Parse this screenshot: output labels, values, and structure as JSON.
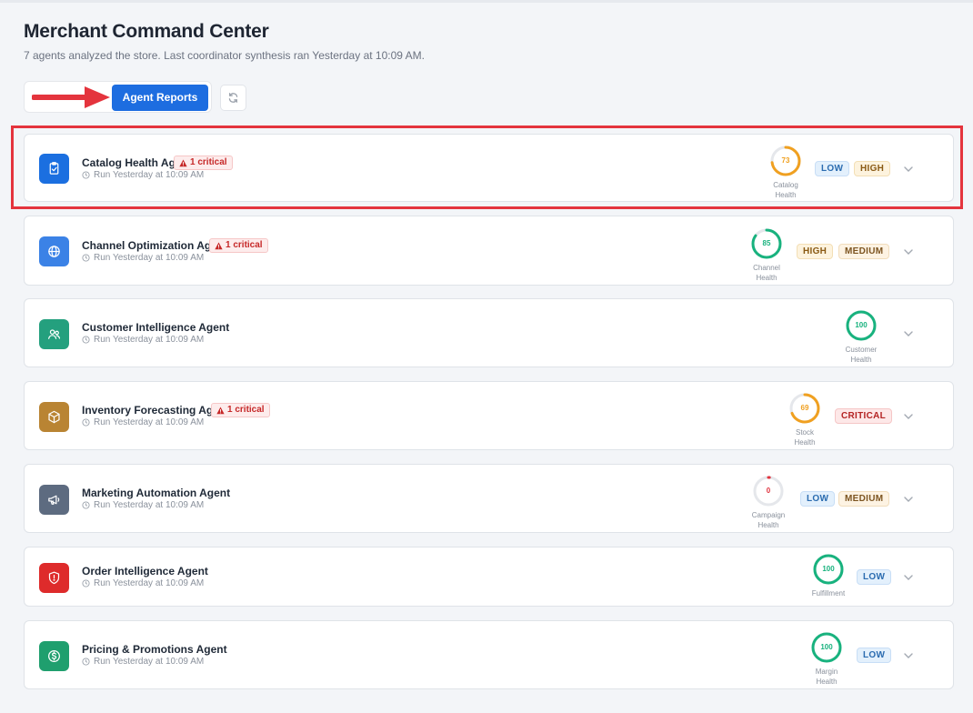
{
  "page": {
    "title": "Merchant Command Center",
    "subtitle": "7 agents analyzed the store. Last coordinator synthesis ran Yesterday at 10:09 AM."
  },
  "tabs": {
    "active_label": "Agent Reports"
  },
  "icons": {
    "refresh": "refresh-icon",
    "clock": "clock-icon",
    "chevron": "chevron-down-icon",
    "warning": "warning-triangle-icon"
  },
  "colors": {
    "accent": "#1d6de0",
    "highlight": "#e4343d",
    "gauge_orange": "#f0a020",
    "gauge_green": "#18b27e",
    "gauge_empty": "#e5e7eb"
  },
  "agents": [
    {
      "name": "Catalog Health Agent",
      "critical": "1 critical",
      "run": "Run Yesterday at 10:09 AM",
      "score": "73",
      "score_fraction": 0.73,
      "gauge_color": "#f0a020",
      "metric_line1": "Catalog",
      "metric_line2": "Health",
      "pills": [
        "LOW",
        "HIGH"
      ],
      "icon": "clipboard-check-icon",
      "icon_bg": "#1b6fe0"
    },
    {
      "name": "Channel Optimization Agent",
      "critical": "1 critical",
      "run": "Run Yesterday at 10:09 AM",
      "score": "85",
      "score_fraction": 0.85,
      "gauge_color": "#18b27e",
      "metric_line1": "Channel",
      "metric_line2": "Health",
      "pills": [
        "HIGH",
        "MEDIUM"
      ],
      "icon": "globe-icon",
      "icon_bg": "#3b82e6"
    },
    {
      "name": "Customer Intelligence Agent",
      "critical": "",
      "run": "Run Yesterday at 10:09 AM",
      "score": "100",
      "score_fraction": 1.0,
      "gauge_color": "#18b27e",
      "metric_line1": "Customer",
      "metric_line2": "Health",
      "pills": [],
      "icon": "users-icon",
      "icon_bg": "#24a07e"
    },
    {
      "name": "Inventory Forecasting Agent",
      "critical": "1 critical",
      "run": "Run Yesterday at 10:09 AM",
      "score": "69",
      "score_fraction": 0.69,
      "gauge_color": "#f0a020",
      "metric_line1": "Stock",
      "metric_line2": "Health",
      "pills": [
        "CRITICAL"
      ],
      "icon": "box-icon",
      "icon_bg": "#b98433"
    },
    {
      "name": "Marketing Automation Agent",
      "critical": "",
      "run": "Run Yesterday at 10:09 AM",
      "score": "0",
      "score_fraction": 0.0,
      "gauge_color": "#e0333e",
      "metric_line1": "Campaign",
      "metric_line2": "Health",
      "pills": [
        "LOW",
        "MEDIUM"
      ],
      "icon": "megaphone-icon",
      "icon_bg": "#5d6b80"
    },
    {
      "name": "Order Intelligence Agent",
      "critical": "",
      "run": "Run Yesterday at 10:09 AM",
      "score": "100",
      "score_fraction": 1.0,
      "gauge_color": "#18b27e",
      "metric_line1": "Fulfillment",
      "metric_line2": "",
      "pills": [
        "LOW"
      ],
      "icon": "shield-alert-icon",
      "icon_bg": "#de2b2b"
    },
    {
      "name": "Pricing & Promotions Agent",
      "critical": "",
      "run": "Run Yesterday at 10:09 AM",
      "score": "100",
      "score_fraction": 1.0,
      "gauge_color": "#18b27e",
      "metric_line1": "Margin",
      "metric_line2": "Health",
      "pills": [
        "LOW"
      ],
      "icon": "dollar-icon",
      "icon_bg": "#1f9f6e"
    }
  ]
}
